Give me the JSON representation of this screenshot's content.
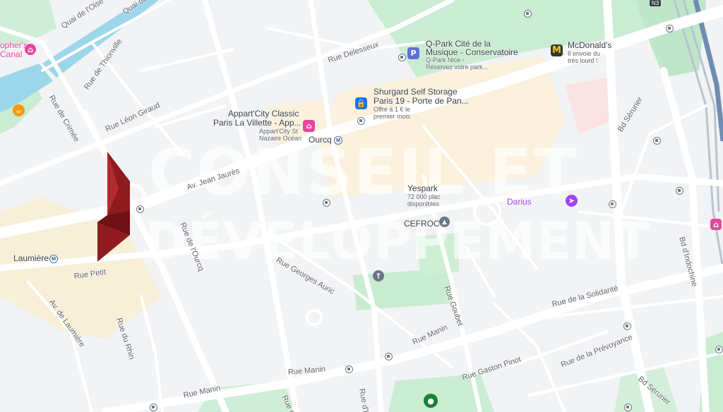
{
  "map": {
    "streets": {
      "quai_oise": "Quai de l'Oise",
      "quai_oise_2": "Quai de la Mo",
      "rue_crimee": "Rue de Crimée",
      "rue_thionville": "Rue de Thionville",
      "rue_leon_giraud": "Rue Léon Giraud",
      "rue_delesseux": "Rue Delesseux",
      "av_jaures": "Av. Jean Jaurès",
      "rue_ourcq": "Rue de l'Ourcq",
      "rue_georges_auric": "Rue Georges Auric",
      "rue_petit": "Rue Petit",
      "av_laumiere": "Av. de Laumière",
      "rue_du_rhin": "Rue du Rhin",
      "rue_manin_1": "Rue Manin",
      "rue_manin_2": "Rue Manin",
      "rue_manin_3": "Rue Manin",
      "rue_goubet": "Rue Goubet",
      "rue_gaston_pinot": "Rue Gaston Pinot",
      "rue_solidarite": "Rue de la Solidarité",
      "rue_prevoyance": "Rue de la Prévoyance",
      "bd_serurier_1": "Bd Sérurier",
      "bd_serurier_2": "Bd Sérurier",
      "bd_indochine": "Bd d'Indochine",
      "rue_hautpoul": "Rue d'Hau",
      "rue_c": "Rue de C",
      "n3": "N3"
    },
    "pois": {
      "qpark": {
        "title": "Q-Park Cité de la Musique - Conservatoire",
        "title_l1": "Q-Park Cité de la",
        "title_l2": "Musique - Conservatoire",
        "sub_l1": "Q-Park Nice -",
        "sub_l2": "Réservez votre park...",
        "icon": "parking-icon",
        "color": "#5e6fd6"
      },
      "mcdonalds": {
        "title_l1": "McDonald's",
        "sub_l1": "Il envoie du",
        "sub_l2": "très lourd !",
        "icon": "mcdonalds-icon",
        "color": "#2d3b2a"
      },
      "shurgard": {
        "title_l1": "Shurgard Self Storage",
        "title_l2": "Paris 19 - Porte de Pan...",
        "sub_l1": "Offre à 1 € le",
        "sub_l2": "premier mois",
        "icon": "lock-icon",
        "color": "#1a73e8"
      },
      "appartcity": {
        "title_l1": "Appart'City Classic",
        "title_l2": "Paris La Villette - App...",
        "sub_l1": "Appart'City St",
        "sub_l2": "Nazaire Océan",
        "icon": "hotel-icon",
        "color": "#e8459c"
      },
      "yespark": {
        "title_l1": "Yespark",
        "sub_l1": "72 000 plac",
        "sub_l2": "disponibles"
      },
      "cefroc": {
        "title_l1": "CEFROC"
      },
      "darius": {
        "title_l1": "Darius",
        "color": "#a142f4"
      },
      "canal": {
        "title_l1": "opher's",
        "title_l2": "Canal"
      },
      "ourcq_metro": "Ourcq",
      "laumiere_metro": "Laumière",
      "metro_letter": "M"
    },
    "watermark": {
      "line1": "CONSEIL ET",
      "line2": "DÉVELOPPEMENT",
      "logo_color": "#8e1b1f"
    }
  }
}
